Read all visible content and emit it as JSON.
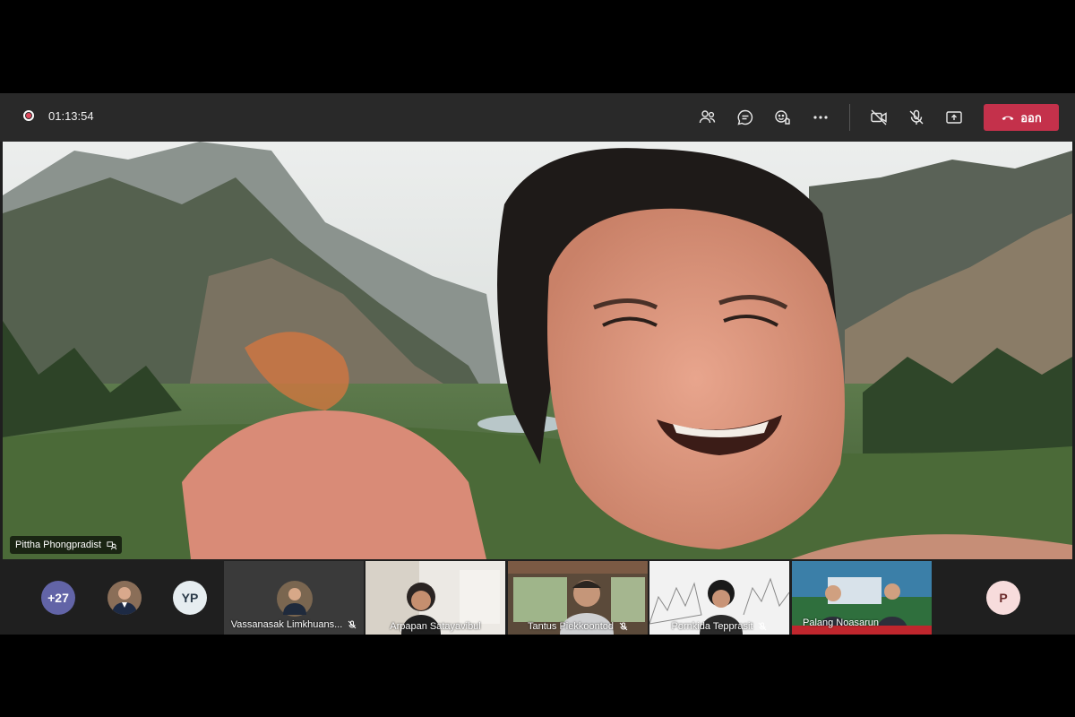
{
  "meeting": {
    "timer": "01:13:54",
    "leave_label": "ออก",
    "toolbar_icons": [
      "participants-icon",
      "chat-icon",
      "reactions-icon",
      "more-icon",
      "camera-off-icon",
      "mic-off-icon",
      "share-icon"
    ]
  },
  "main_speaker": {
    "name": "Pittha Phongpradist"
  },
  "strip": {
    "overflow_count": "+27",
    "avatars": [
      {
        "initials": "YP",
        "color": "#e6edf0"
      },
      {
        "initials": "P",
        "color": "#f7dcdc"
      }
    ],
    "tiles": [
      {
        "name": "Vassanasak Limkhuans..."
      },
      {
        "name": "Arpapan Satayavibul"
      },
      {
        "name": "Tantus Piekkoontod"
      },
      {
        "name": "Pornkida Tepprasit"
      },
      {
        "name": "Palang Noasarun"
      }
    ]
  },
  "colors": {
    "leave": "#c4314b",
    "topbar": "#292929",
    "background": "#1f1f1f",
    "overflow_badge": "#6264a7"
  }
}
